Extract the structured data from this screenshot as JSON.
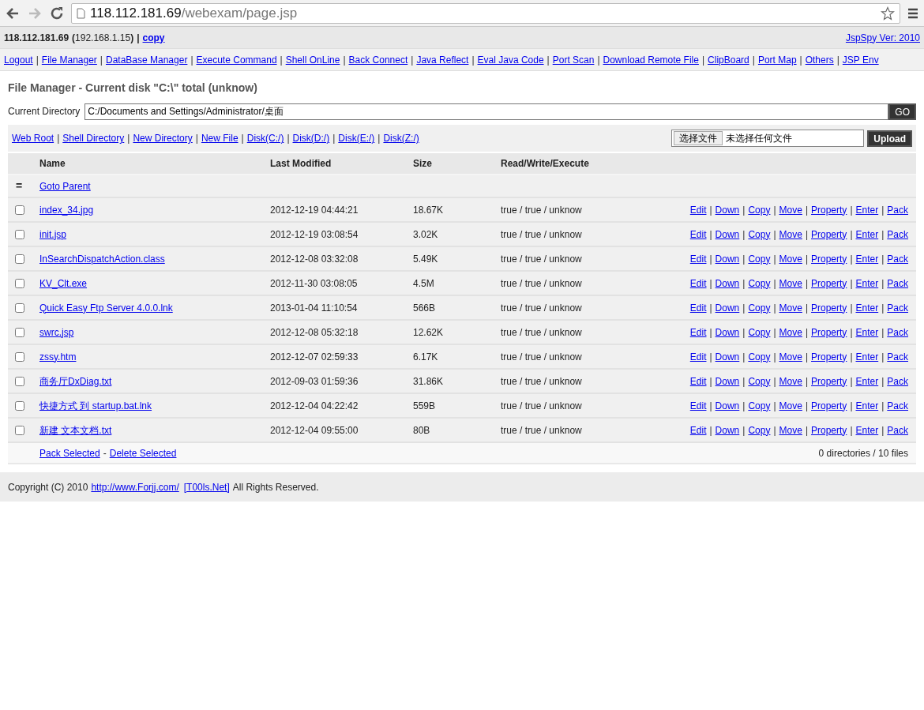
{
  "browser": {
    "url_host": "118.112.181.69",
    "url_path": "/webexam/page.jsp",
    "forward_disabled": true
  },
  "header": {
    "host": "118.112.181.69",
    "local_ip": "**(**192.168.1.15**)**",
    "separator": "|",
    "copy_link": "copy",
    "version_link": "JspSpy Ver: 2010"
  },
  "nav": {
    "separator": "|",
    "links": [
      "Logout",
      "File Manager",
      "DataBase Manager",
      "Execute Command",
      "Shell OnLine",
      "Back Connect",
      "Java Reflect",
      "Eval Java Code",
      "Port Scan",
      "Download Remote File",
      "ClipBoard",
      "Port Map",
      "Others",
      "JSP Env"
    ]
  },
  "title": "File Manager - Current disk \"C:\\\" total (unknow)",
  "directory": {
    "label": "Current Directory",
    "value": "C:/Documents and Settings/Administrator/桌面",
    "button": "GO"
  },
  "toolbar": {
    "separator": "|",
    "links": [
      "Web Root",
      "Shell Directory",
      "New Directory",
      "New File",
      "Disk(C:/)",
      "Disk(D:/)",
      "Disk(E:/)",
      "Disk(Z:/)"
    ],
    "file_button": "选择文件",
    "file_status": "未选择任何文件",
    "upload": "Upload"
  },
  "table": {
    "columns": [
      "Name",
      "Last Modified",
      "Size",
      "Read/Write/Execute"
    ],
    "parent": {
      "icon": "=",
      "label": "Goto Parent"
    },
    "separator": "|",
    "rows": [
      {
        "name": "index_34.jpg",
        "modified": "2012-12-19 04:44:21",
        "size": "18.67K",
        "rwx": "true / true / unknow",
        "checked": false,
        "actions": [
          "Edit",
          "Down",
          "Copy",
          "Move",
          "Property",
          "Enter",
          "Pack"
        ]
      },
      {
        "name": "init.jsp",
        "modified": "2012-12-19 03:08:54",
        "size": "3.02K",
        "rwx": "true / true / unknow",
        "checked": false,
        "actions": [
          "Edit",
          "Down",
          "Copy",
          "Move",
          "Property",
          "Enter",
          "Pack"
        ]
      },
      {
        "name": "InSearchDispatchAction.class",
        "modified": "2012-12-08 03:32:08",
        "size": "5.49K",
        "rwx": "true / true / unknow",
        "checked": false,
        "actions": [
          "Edit",
          "Down",
          "Copy",
          "Move",
          "Property",
          "Enter",
          "Pack"
        ]
      },
      {
        "name": "KV_Clt.exe",
        "modified": "2012-11-30 03:08:05",
        "size": "4.5M",
        "rwx": "true / true / unknow",
        "checked": false,
        "actions": [
          "Edit",
          "Down",
          "Copy",
          "Move",
          "Property",
          "Enter",
          "Pack"
        ]
      },
      {
        "name": "Quick Easy Ftp Server 4.0.0.lnk",
        "modified": "2013-01-04 11:10:54",
        "size": "566B",
        "rwx": "true / true / unknow",
        "checked": false,
        "actions": [
          "Edit",
          "Down",
          "Copy",
          "Move",
          "Property",
          "Enter",
          "Pack"
        ]
      },
      {
        "name": "swrc.jsp",
        "modified": "2012-12-08 05:32:18",
        "size": "12.62K",
        "rwx": "true / true / unknow",
        "checked": false,
        "actions": [
          "Edit",
          "Down",
          "Copy",
          "Move",
          "Property",
          "Enter",
          "Pack"
        ]
      },
      {
        "name": "zssy.htm",
        "modified": "2012-12-07 02:59:33",
        "size": "6.17K",
        "rwx": "true / true / unknow",
        "checked": false,
        "actions": [
          "Edit",
          "Down",
          "Copy",
          "Move",
          "Property",
          "Enter",
          "Pack"
        ]
      },
      {
        "name": "商务厅DxDiag.txt",
        "modified": "2012-09-03 01:59:36",
        "size": "31.86K",
        "rwx": "true / true / unknow",
        "checked": false,
        "actions": [
          "Edit",
          "Down",
          "Copy",
          "Move",
          "Property",
          "Enter",
          "Pack"
        ]
      },
      {
        "name": "快捷方式 到 startup.bat.lnk",
        "modified": "2012-12-04 04:22:42",
        "size": "559B",
        "rwx": "true / true / unknow",
        "checked": false,
        "actions": [
          "Edit",
          "Down",
          "Copy",
          "Move",
          "Property",
          "Enter",
          "Pack"
        ]
      },
      {
        "name": "新建 文本文档.txt",
        "modified": "2012-12-04 09:55:00",
        "size": "80B",
        "rwx": "true / true / unknow",
        "checked": false,
        "actions": [
          "Edit",
          "Down",
          "Copy",
          "Move",
          "Property",
          "Enter",
          "Pack"
        ]
      }
    ],
    "footer": {
      "pack": "Pack Selected",
      "dash": "-",
      "delete": "Delete Selected",
      "summary": "0 directories / 10 files"
    }
  },
  "copyright": {
    "before": "Copyright (C) 2010",
    "link1": "http://www.Forjj.com/",
    "link2": "[T00ls.Net]",
    "after": "All Rights Reserved."
  }
}
